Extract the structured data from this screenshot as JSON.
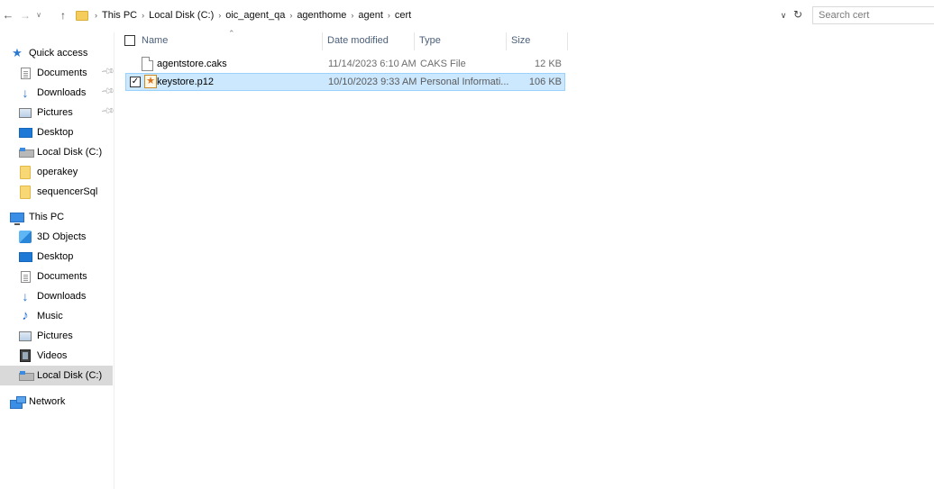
{
  "address_bar": {
    "back_icon": "back-arrow-icon",
    "forward_icon": "forward-arrow-icon",
    "recent_icon": "recent-locations-chevron-icon",
    "up_icon": "up-arrow-icon",
    "breadcrumbs": [
      "This PC",
      "Local Disk (C:)",
      "oic_agent_qa",
      "agenthome",
      "agent",
      "cert"
    ],
    "search_placeholder": "Search cert"
  },
  "sidebar": {
    "quick_access": {
      "label": "Quick access",
      "items": [
        {
          "label": "Documents",
          "icon": "documents-icon",
          "pinned": true
        },
        {
          "label": "Downloads",
          "icon": "downloads-icon",
          "pinned": true
        },
        {
          "label": "Pictures",
          "icon": "pictures-icon",
          "pinned": true
        },
        {
          "label": "Desktop",
          "icon": "desktop-icon",
          "pinned": false
        },
        {
          "label": "Local Disk (C:)",
          "icon": "drive-icon",
          "pinned": false
        },
        {
          "label": "operakey",
          "icon": "folder-icon",
          "pinned": false
        },
        {
          "label": "sequencerSql",
          "icon": "folder-icon",
          "pinned": false
        }
      ]
    },
    "this_pc": {
      "label": "This PC",
      "items": [
        {
          "label": "3D Objects",
          "icon": "3d-objects-icon"
        },
        {
          "label": "Desktop",
          "icon": "desktop-icon"
        },
        {
          "label": "Documents",
          "icon": "documents-icon"
        },
        {
          "label": "Downloads",
          "icon": "downloads-icon"
        },
        {
          "label": "Music",
          "icon": "music-icon"
        },
        {
          "label": "Pictures",
          "icon": "pictures-icon"
        },
        {
          "label": "Videos",
          "icon": "videos-icon"
        },
        {
          "label": "Local Disk (C:)",
          "icon": "drive-icon",
          "selected": true
        }
      ]
    },
    "network": {
      "label": "Network",
      "icon": "network-icon"
    }
  },
  "file_list": {
    "columns": {
      "name": "Name",
      "date_modified": "Date modified",
      "type": "Type",
      "size": "Size"
    },
    "files": [
      {
        "name": "agentstore.caks",
        "date_modified": "11/14/2023 6:10 AM",
        "type": "CAKS File",
        "size": "12 KB",
        "icon": "blank-file-icon",
        "selected": false
      },
      {
        "name": "keystore.p12",
        "date_modified": "10/10/2023 9:33 AM",
        "type": "Personal Informati...",
        "size": "106 KB",
        "icon": "certificate-file-icon",
        "selected": true
      }
    ]
  },
  "colors": {
    "selection_bg": "#cce8ff",
    "selection_border": "#99d1ff",
    "nav_selected_bg": "#d9d9d9",
    "header_text": "#4c607a"
  }
}
